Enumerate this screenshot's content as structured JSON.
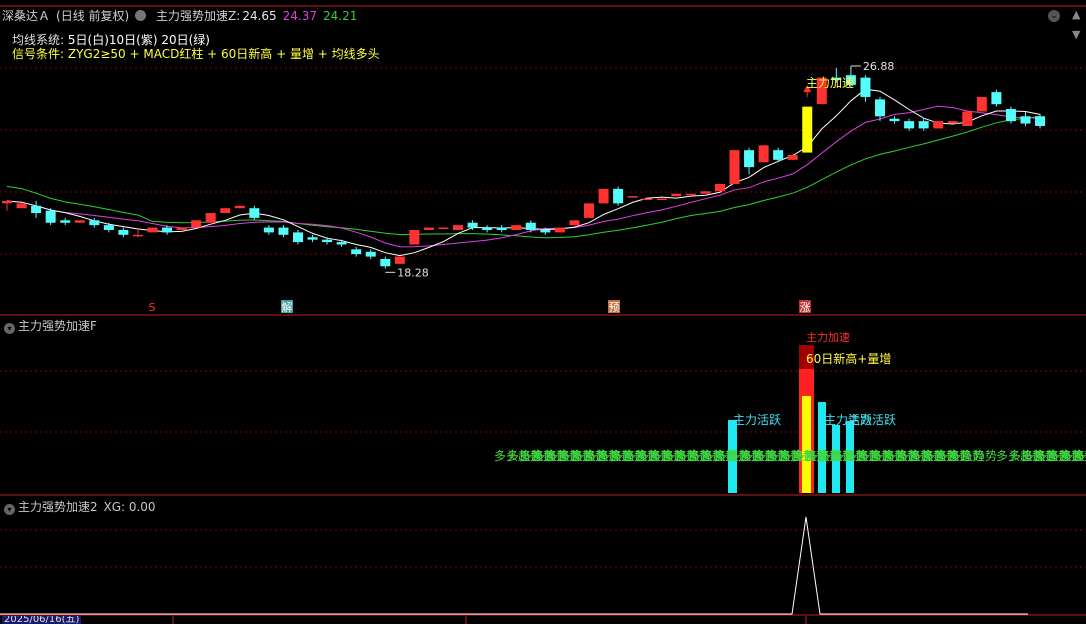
{
  "header": {
    "stock_name": "深桑达Ａ",
    "period": "(日线 前复权)",
    "indicator_prefix": "主力强势加速Z",
    "value_label": "24.65",
    "value_2": "24.37",
    "value_3": "24.21"
  },
  "ma_system": {
    "label": "均线系统:",
    "ma5": "5日(白)",
    "ma10": "10日(紫)",
    "ma20": "20日(绿)"
  },
  "signal": {
    "label": "信号条件:",
    "text": "ZYG2≥50 + MACD红柱 + 60日新高 + 量增 + 均线多头"
  },
  "price_annotations": {
    "high": "26.88",
    "low": "18.28",
    "accel_label": "主力加速"
  },
  "markers": [
    {
      "text": "S",
      "color": "#ff3030",
      "bg": "#000000"
    },
    {
      "text": "解",
      "color": "#ffffff",
      "bg": "#4aa0a0"
    },
    {
      "text": "预",
      "color": "#ffffff",
      "bg": "#c07040"
    },
    {
      "text": "涨",
      "color": "#ffffff",
      "bg": "#c03030"
    }
  ],
  "panel2": {
    "title": "主力强势加速F",
    "top_label": "主力加速",
    "new_high_label": "60日新高+量增",
    "active_label": "主力活跃",
    "active_label2": "主力活跃",
    "trend_label": "多头趋势"
  },
  "panel3": {
    "title": "主力强势加速2",
    "xg": "XG: 0.00"
  },
  "bottom": {
    "date": "2025/06/16(五)"
  },
  "colors": {
    "up": "#ff3232",
    "down": "#54fcfc",
    "ma5": "#ffffff",
    "ma10": "#e040e0",
    "ma20": "#30d030",
    "grid": "#8b0000",
    "accel_bar": "#ffff00",
    "trend_text": "#40d840"
  },
  "chart_data": {
    "type": "candlestick",
    "candles": [
      [
        21.2,
        21.3,
        20.7,
        20.9
      ],
      [
        21.0,
        21.2,
        20.8,
        21.0
      ],
      [
        21.1,
        20.8,
        21.3,
        20.6
      ],
      [
        20.9,
        20.4,
        21.0,
        20.3
      ],
      [
        20.5,
        20.4,
        20.6,
        20.3
      ],
      [
        20.4,
        20.5,
        20.3,
        20.6
      ],
      [
        20.5,
        20.3,
        20.6,
        20.2
      ],
      [
        20.3,
        20.1,
        20.4,
        20.0
      ],
      [
        20.1,
        19.9,
        20.2,
        19.8
      ],
      [
        19.9,
        19.9,
        20.1,
        19.8
      ],
      [
        20.0,
        20.2,
        19.9,
        20.3
      ],
      [
        20.2,
        20.0,
        20.3,
        19.9
      ],
      [
        20.1,
        20.2,
        20.0,
        20.3
      ],
      [
        20.2,
        20.5,
        20.1,
        20.6
      ],
      [
        20.4,
        20.8,
        20.3,
        20.9
      ],
      [
        20.8,
        21.0,
        20.7,
        21.3
      ],
      [
        21.0,
        21.1,
        20.9,
        21.2
      ],
      [
        21.0,
        20.6,
        21.1,
        20.5
      ],
      [
        20.2,
        20.0,
        20.3,
        19.9
      ],
      [
        20.2,
        19.9,
        20.3,
        19.8
      ],
      [
        20.0,
        19.6,
        20.1,
        19.5
      ],
      [
        19.8,
        19.7,
        19.9,
        19.6
      ],
      [
        19.7,
        19.6,
        19.8,
        19.5
      ],
      [
        19.6,
        19.5,
        19.7,
        19.4
      ],
      [
        19.3,
        19.1,
        19.4,
        19.0
      ],
      [
        19.2,
        19.0,
        19.3,
        18.9
      ],
      [
        18.9,
        18.6,
        19.0,
        18.5
      ],
      [
        18.7,
        19.0,
        18.6,
        19.1
      ],
      [
        19.5,
        20.1,
        19.4,
        20.8
      ],
      [
        20.1,
        20.2,
        20.0,
        20.5
      ],
      [
        20.2,
        20.2,
        20.0,
        20.3
      ],
      [
        20.1,
        20.3,
        20.0,
        20.4
      ],
      [
        20.4,
        20.2,
        20.5,
        20.1
      ],
      [
        20.2,
        20.1,
        20.3,
        20.0
      ],
      [
        20.2,
        20.1,
        20.3,
        20.0
      ],
      [
        20.1,
        20.3,
        20.0,
        20.6
      ],
      [
        20.4,
        20.1,
        20.5,
        20.0
      ],
      [
        20.1,
        20.0,
        20.2,
        19.9
      ],
      [
        20.0,
        20.2,
        19.9,
        20.3
      ],
      [
        20.3,
        20.5,
        20.2,
        20.6
      ],
      [
        20.6,
        21.2,
        20.5,
        21.4
      ],
      [
        21.2,
        21.8,
        21.1,
        21.9
      ],
      [
        21.8,
        21.2,
        21.9,
        21.1
      ],
      [
        21.5,
        21.5,
        21.4,
        21.7
      ],
      [
        21.4,
        21.4,
        21.3,
        21.6
      ],
      [
        21.4,
        21.4,
        21.3,
        21.7
      ],
      [
        21.5,
        21.6,
        21.4,
        21.8
      ],
      [
        21.6,
        21.6,
        21.5,
        21.8
      ],
      [
        21.6,
        21.7,
        21.5,
        21.9
      ],
      [
        21.7,
        22.0,
        21.6,
        22.2
      ],
      [
        22.0,
        23.4,
        21.9,
        24.1
      ],
      [
        23.4,
        22.7,
        23.5,
        22.4
      ],
      [
        22.9,
        23.6,
        22.6,
        23.9
      ],
      [
        23.4,
        23.0,
        23.5,
        22.9
      ],
      [
        23.0,
        23.2,
        22.9,
        23.5
      ],
      [
        23.3,
        25.2,
        23.2,
        25.5
      ],
      [
        25.3,
        26.4,
        25.2,
        26.6
      ],
      [
        26.4,
        26.3,
        26.8,
        26.2
      ],
      [
        26.5,
        26.1,
        26.88,
        26.0
      ],
      [
        26.4,
        25.6,
        26.5,
        25.4
      ],
      [
        25.5,
        24.8,
        25.6,
        24.6
      ],
      [
        24.7,
        24.6,
        24.8,
        24.5
      ],
      [
        24.6,
        24.3,
        24.7,
        24.2
      ],
      [
        24.6,
        24.3,
        24.7,
        24.2
      ],
      [
        24.3,
        24.6,
        24.2,
        24.7
      ],
      [
        24.5,
        24.6,
        24.4,
        24.8
      ],
      [
        24.4,
        25.0,
        24.3,
        25.2
      ],
      [
        25.0,
        25.6,
        24.9,
        25.7
      ],
      [
        25.8,
        25.3,
        25.9,
        25.2
      ],
      [
        25.1,
        24.6,
        25.2,
        24.5
      ],
      [
        24.8,
        24.5,
        25.0,
        24.4
      ],
      [
        24.8,
        24.4,
        24.9,
        24.3
      ]
    ],
    "low_point": 18.28,
    "high_point": 26.88
  }
}
